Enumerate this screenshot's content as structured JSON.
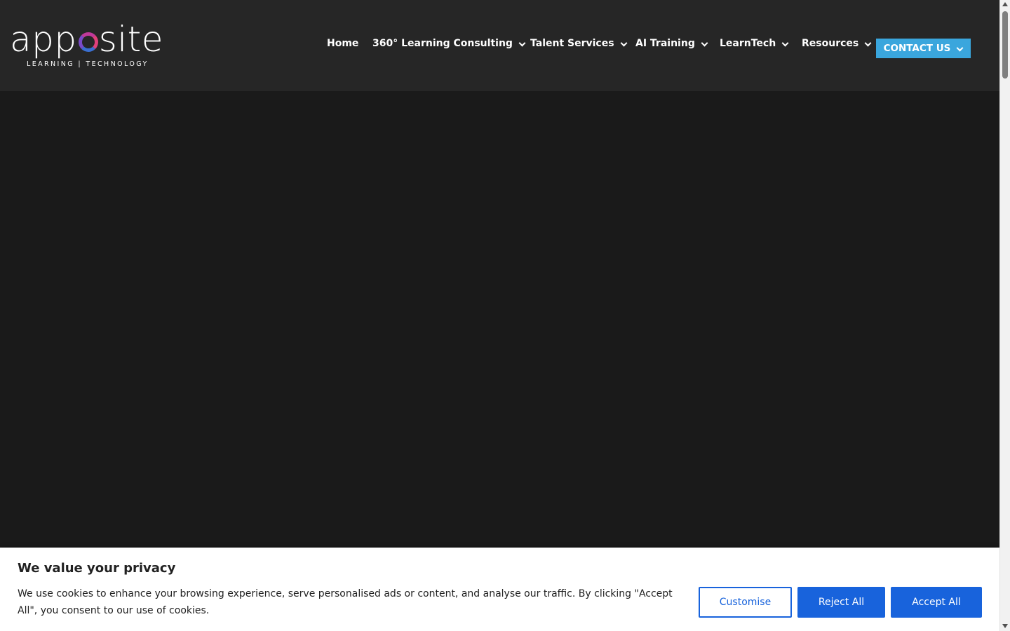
{
  "logo": {
    "word": "apposite",
    "tagline": "LEARNING | TECHNOLOGY",
    "accent_colors": [
      "#7a4ac8",
      "#c0399a",
      "#e0407a",
      "#3a6fd0"
    ]
  },
  "nav": {
    "items": [
      {
        "label": "Home",
        "has_dropdown": false
      },
      {
        "label": "360° Learning Consulting",
        "has_dropdown": true
      },
      {
        "label": "Talent Services",
        "has_dropdown": true
      },
      {
        "label": "AI Training",
        "has_dropdown": true
      },
      {
        "label": "LearnTech",
        "has_dropdown": true
      },
      {
        "label": "Resources",
        "has_dropdown": true
      }
    ],
    "contact_label": "CONTACT US",
    "contact_color": "#3aa6dd"
  },
  "cookie_banner": {
    "title": "We value your privacy",
    "text": "We use cookies to enhance your browsing experience, serve personalised ads or content, and analyse our traffic. By clicking \"Accept All\", you consent to our use of cookies.",
    "customise_label": "Customise",
    "reject_label": "Reject All",
    "accept_label": "Accept All",
    "button_color": "#1863dc"
  }
}
